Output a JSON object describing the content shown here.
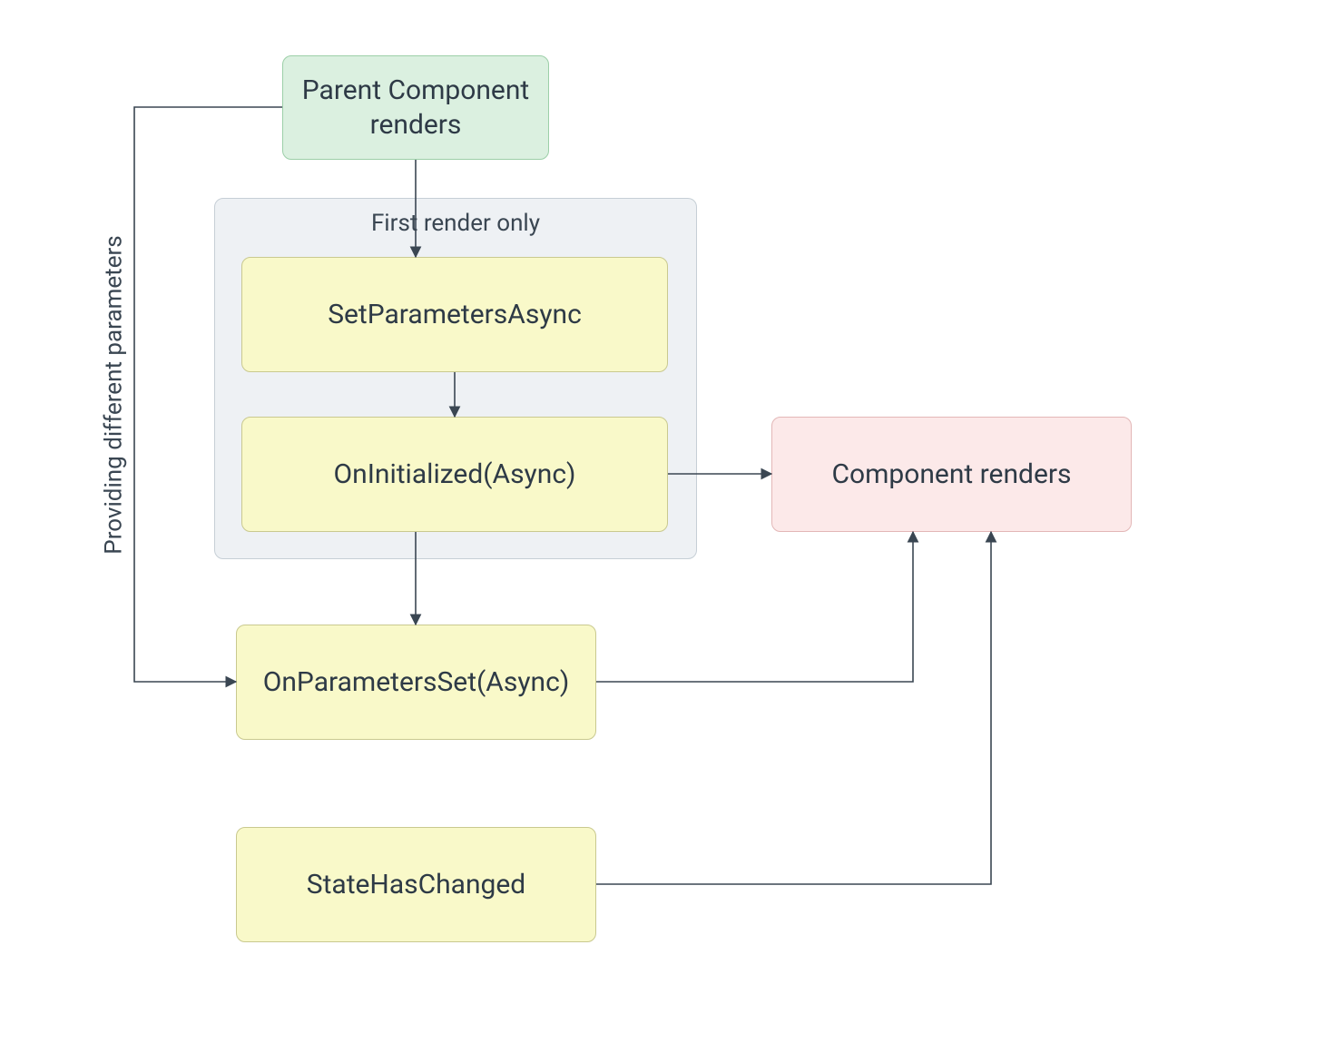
{
  "nodes": {
    "parent": {
      "label": "Parent Component\nrenders"
    },
    "setparams": {
      "label": "SetParametersAsync"
    },
    "oninit": {
      "label": "OnInitialized(Async)"
    },
    "onparams": {
      "label": "OnParametersSet(Async)"
    },
    "statechanged": {
      "label": "StateHasChanged"
    },
    "renders": {
      "label": "Component renders"
    }
  },
  "group": {
    "title": "First render only"
  },
  "edges": {
    "providing": {
      "label": "Providing different parameters"
    }
  },
  "colors": {
    "green_bg": "#dbf0e0",
    "yellow_bg": "#f9f9c9",
    "pink_bg": "#fce9e9",
    "group_bg": "#eef1f4",
    "stroke": "#3a4652"
  }
}
